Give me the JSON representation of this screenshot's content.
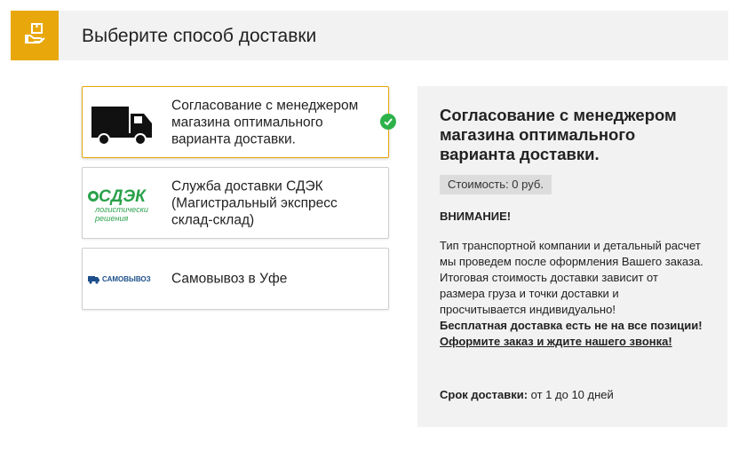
{
  "header": {
    "title": "Выберите способ доставки",
    "icon": "hand-package-icon",
    "accent_color": "#e8a80c"
  },
  "options": [
    {
      "label": "Согласование с менеджером магазина оптимального варианта доставки.",
      "icon": "truck-icon",
      "selected": true
    },
    {
      "label": "Служба доставки СДЭК (Магистральный экспресс склад-склад)",
      "icon": "cdek-logo",
      "logo_text": "СДЭК",
      "logo_subtext": "логистические решения",
      "selected": false
    },
    {
      "label": "Самовывоз в Уфе",
      "icon": "pickup-logo",
      "logo_text": "САМОВЫВОЗ",
      "selected": false
    }
  ],
  "details": {
    "title": "Согласование с менеджером магазина оптимального варианта доставки.",
    "cost": "Стоимость: 0 руб.",
    "attention": "ВНИМАНИЕ!",
    "note_line1": "Тип транспортной компании и детальный расчет мы проведем после оформления Вашего заказа.",
    "note_line2": "Итоговая стоимость доставки зависит от размера груза и точки доставки и просчитывается индивидуально!",
    "note_bold": "Бесплатная доставка есть не на все позиции!",
    "note_link": "Оформите заказ и ждите нашего звонка!",
    "term_label": "Срок доставки:",
    "term_value": " от 1 до 10 дней"
  }
}
